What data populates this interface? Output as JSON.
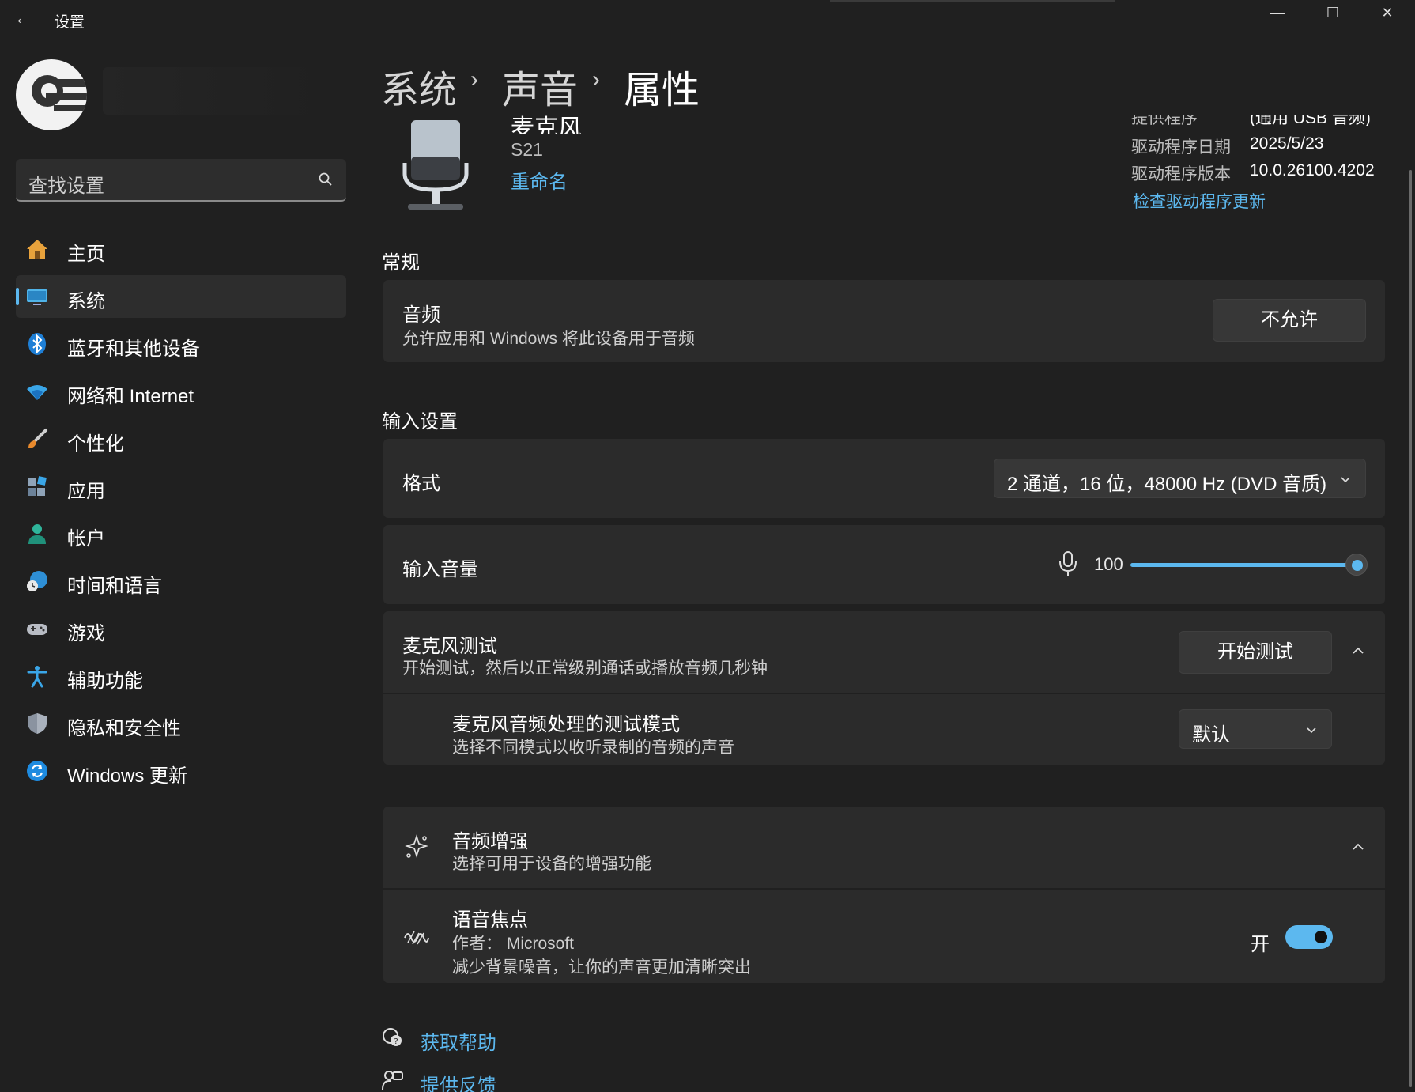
{
  "titlebar": {
    "title": "设置",
    "back_icon": "arrow-left-icon",
    "minimize_icon": "minimize-icon",
    "maximize_icon": "maximize-icon",
    "close_icon": "close-icon"
  },
  "sidebar": {
    "search_placeholder": "查找设置",
    "items": [
      {
        "label": "主页",
        "icon": "home-icon"
      },
      {
        "label": "系统",
        "icon": "system-icon",
        "selected": true
      },
      {
        "label": "蓝牙和其他设备",
        "icon": "bluetooth-icon"
      },
      {
        "label": "网络和 Internet",
        "icon": "wifi-icon"
      },
      {
        "label": "个性化",
        "icon": "brush-icon"
      },
      {
        "label": "应用",
        "icon": "apps-icon"
      },
      {
        "label": "帐户",
        "icon": "account-icon"
      },
      {
        "label": "时间和语言",
        "icon": "globe-clock-icon"
      },
      {
        "label": "游戏",
        "icon": "gamepad-icon"
      },
      {
        "label": "辅助功能",
        "icon": "accessibility-icon"
      },
      {
        "label": "隐私和安全性",
        "icon": "shield-icon"
      },
      {
        "label": "Windows 更新",
        "icon": "update-icon"
      }
    ]
  },
  "breadcrumb": [
    "系统",
    "声音",
    "属性"
  ],
  "device": {
    "name": "麦克风",
    "model": "S21",
    "rename": "重命名",
    "driver": {
      "provider_label": "提供程序",
      "provider_value": "(通用 USB 音频)",
      "date_label": "驱动程序日期",
      "date_value": "2025/5/23",
      "version_label": "驱动程序版本",
      "version_value": "10.0.26100.4202",
      "update_link": "检查驱动程序更新"
    }
  },
  "general": {
    "section": "常规",
    "audio_title": "音频",
    "audio_desc": "允许应用和 Windows 将此设备用于音频",
    "audio_button": "不允许"
  },
  "input": {
    "section": "输入设置",
    "format_label": "格式",
    "format_value": "2 通道，16 位，48000 Hz (DVD 音质)",
    "volume_label": "输入音量",
    "volume_value": "100",
    "volume_level": 1.0,
    "test_title": "麦克风测试",
    "test_desc": "开始测试，然后以正常级别通话或播放音频几秒钟",
    "test_button": "开始测试",
    "mode_title": "麦克风音频处理的测试模式",
    "mode_desc": "选择不同模式以收听录制的音频的声音",
    "mode_value": "默认"
  },
  "enhancements": {
    "title": "音频增强",
    "desc": "选择可用于设备的增强功能",
    "voice_focus_title": "语音焦点",
    "voice_focus_author": "作者： Microsoft",
    "voice_focus_desc": "减少背景噪音，让你的声音更加清晰突出",
    "voice_focus_state": "开",
    "voice_focus_on": true
  },
  "footer": {
    "help": "获取帮助",
    "feedback": "提供反馈"
  },
  "colors": {
    "accent": "#5cb8ef",
    "background": "#202020",
    "card": "#2b2b2b"
  }
}
